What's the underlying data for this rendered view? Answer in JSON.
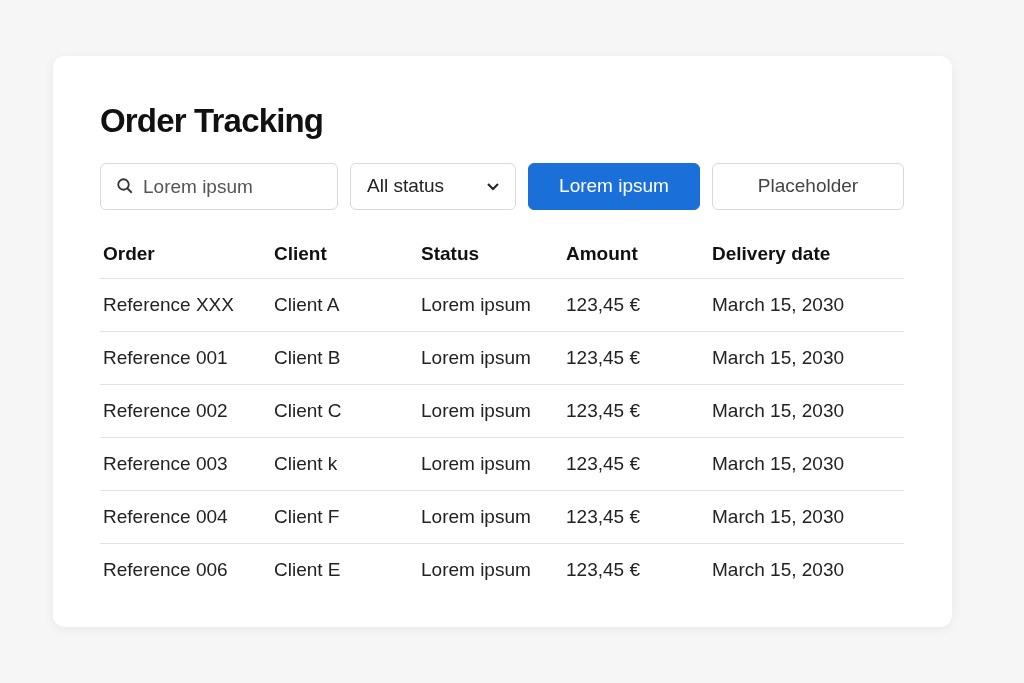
{
  "title": "Order Tracking",
  "toolbar": {
    "search": {
      "placeholder": "Lorem ipsum"
    },
    "filter": {
      "value": "All status"
    },
    "buttons": [
      {
        "label": "Lorem ipsum",
        "kind": "primary"
      },
      {
        "label": "Placeholder",
        "kind": "secondary"
      }
    ]
  },
  "table": {
    "columns": [
      "Order",
      "Client",
      "Status",
      "Amount",
      "Delivery date"
    ],
    "rows": [
      [
        "Reference XXX",
        "Client A",
        "Lorem ipsum",
        "123,45 €",
        "March 15, 2030"
      ],
      [
        "Reference 001",
        "Client B",
        "Lorem ipsum",
        "123,45 €",
        "March 15, 2030"
      ],
      [
        "Reference 002",
        "Client C",
        "Lorem ipsum",
        "123,45 €",
        "March 15, 2030"
      ],
      [
        "Reference 003",
        "Client k",
        "Lorem ipsum",
        "123,45 €",
        "March 15, 2030"
      ],
      [
        "Reference 004",
        "Client F",
        "Lorem ipsum",
        "123,45 €",
        "March 15, 2030"
      ],
      [
        "Reference 006",
        "Client E",
        "Lorem ipsum",
        "123,45 €",
        "March 15, 2030"
      ]
    ]
  }
}
